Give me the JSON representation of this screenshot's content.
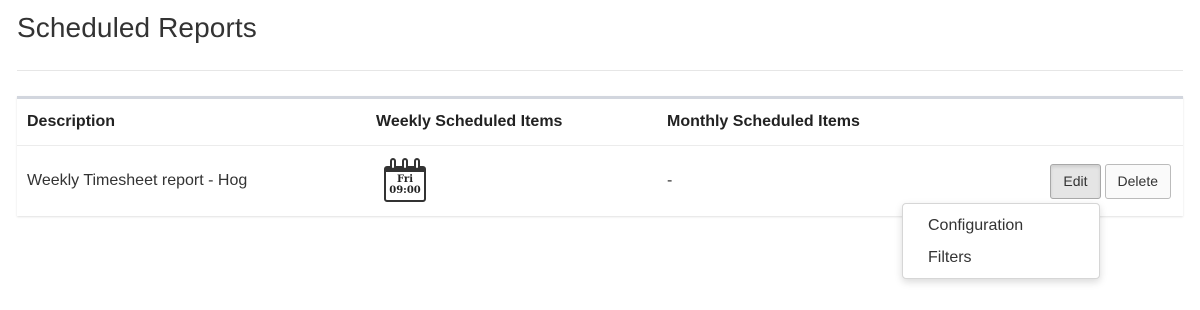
{
  "page": {
    "title": "Scheduled Reports"
  },
  "table": {
    "columns": [
      "Description",
      "Weekly Scheduled Items",
      "Monthly Scheduled Items"
    ],
    "rows": [
      {
        "description": "Weekly Timesheet report - Hog",
        "weekly": {
          "icon": "calendar-icon",
          "day": "Fri",
          "time": "09:00"
        },
        "monthly": "-",
        "actions": {
          "edit_label": "Edit",
          "delete_label": "Delete"
        }
      }
    ]
  },
  "edit_menu": {
    "items": [
      "Configuration",
      "Filters"
    ]
  }
}
